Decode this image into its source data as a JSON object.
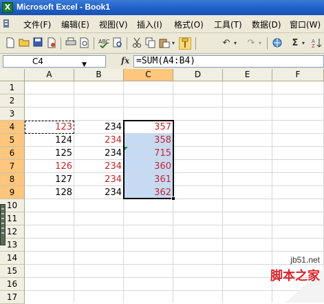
{
  "window": {
    "title": "Microsoft Excel - Book1",
    "app_icon": "excel-icon"
  },
  "menu": {
    "items": [
      "文件(F)",
      "编辑(E)",
      "视图(V)",
      "插入(I)",
      "格式(O)",
      "工具(T)",
      "数据(D)",
      "窗口(W)"
    ]
  },
  "toolbar": {
    "icons": [
      "new-icon",
      "open-icon",
      "save-icon",
      "permission-icon",
      "print-icon",
      "print-preview-icon",
      "spelling-icon",
      "research-icon",
      "cut-icon",
      "copy-icon",
      "paste-icon",
      "format-painter-icon",
      "undo-icon",
      "redo-icon",
      "hyperlink-icon",
      "autosum-icon",
      "sort-icon"
    ],
    "autosum_glyph": "Σ"
  },
  "formula_bar": {
    "name_box": "C4",
    "fx_label": "fx",
    "formula": "=SUM(A4:B4)"
  },
  "grid": {
    "columns": [
      "A",
      "B",
      "C",
      "D",
      "E",
      "F"
    ],
    "selected_column": "C",
    "rows": [
      "1",
      "2",
      "3",
      "4",
      "5",
      "6",
      "7",
      "8",
      "9",
      "10",
      "11",
      "12",
      "13",
      "14",
      "15",
      "16",
      "17"
    ],
    "selected_rows": [
      "4",
      "5",
      "6",
      "7",
      "8",
      "9"
    ],
    "cells": {
      "A4": "123",
      "B4": "234",
      "C4": "357",
      "A5": "124",
      "B5": "234",
      "C5": "358",
      "A6": "125",
      "B6": "234",
      "C6": "715",
      "A7": "126",
      "B7": "234",
      "C7": "360",
      "A8": "127",
      "B8": "234",
      "C8": "361",
      "A9": "128",
      "B9": "234",
      "C9": "362"
    },
    "red_cells": [
      "A4",
      "C4",
      "B5",
      "C5",
      "C6",
      "A7",
      "B7",
      "C7",
      "B8",
      "C8",
      "C9"
    ]
  },
  "colors": {
    "selection_fill": "#c6daf4",
    "header_highlight": "#ffc67d",
    "red_text": "#c8242a"
  },
  "watermark": {
    "url": "jb51.net",
    "name": "脚本之家"
  }
}
